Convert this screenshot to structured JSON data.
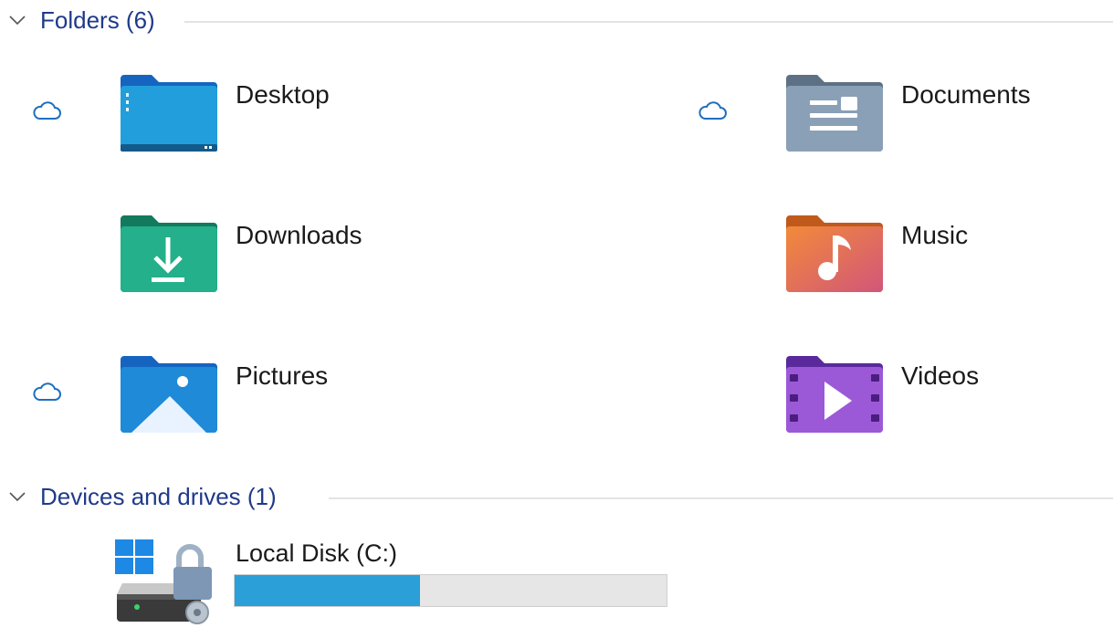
{
  "groups": {
    "folders": {
      "title": "Folders (6)"
    },
    "devices": {
      "title": "Devices and drives (1)"
    }
  },
  "folders": [
    {
      "name": "Desktop",
      "icon": "desktop-folder-icon",
      "cloud": true
    },
    {
      "name": "Documents",
      "icon": "documents-folder-icon",
      "cloud": true
    },
    {
      "name": "Downloads",
      "icon": "downloads-folder-icon",
      "cloud": false
    },
    {
      "name": "Music",
      "icon": "music-folder-icon",
      "cloud": false
    },
    {
      "name": "Pictures",
      "icon": "pictures-folder-icon",
      "cloud": true
    },
    {
      "name": "Videos",
      "icon": "videos-folder-icon",
      "cloud": false
    }
  ],
  "drives": [
    {
      "name": "Local Disk (C:)",
      "icon": "locked-windows-drive-icon",
      "used_fraction": 0.43
    }
  ],
  "colors": {
    "header_text": "#1f3a8a",
    "cloud_icon": "#1e6fbf",
    "usage_fill": "#2a9fd8",
    "usage_track": "#e6e6e6"
  }
}
